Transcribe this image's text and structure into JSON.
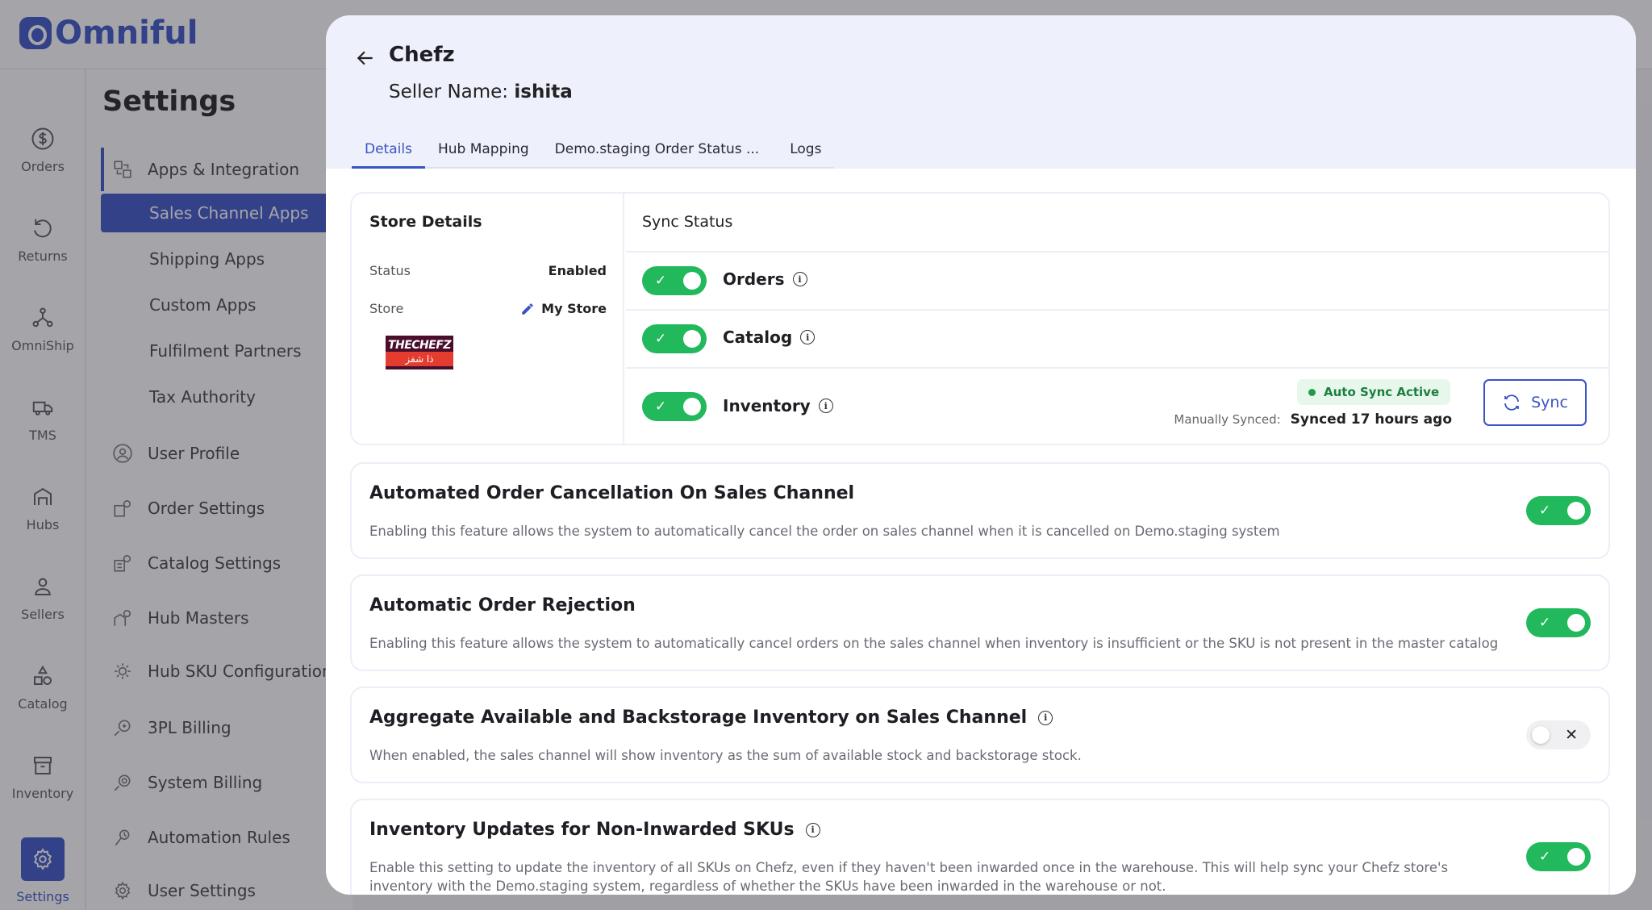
{
  "brand": {
    "name": "Omniful"
  },
  "rail": {
    "items": [
      {
        "label": "Orders",
        "icon": "dollar-circle-icon"
      },
      {
        "label": "Returns",
        "icon": "return-arrow-icon"
      },
      {
        "label": "OmniShip",
        "icon": "network-icon"
      },
      {
        "label": "TMS",
        "icon": "truck-icon"
      },
      {
        "label": "Hubs",
        "icon": "warehouse-icon"
      },
      {
        "label": "Sellers",
        "icon": "user-icon"
      },
      {
        "label": "Catalog",
        "icon": "shapes-icon"
      },
      {
        "label": "Inventory",
        "icon": "box-icon"
      },
      {
        "label": "Settings",
        "icon": "gear-icon"
      }
    ]
  },
  "settings": {
    "title": "Settings",
    "nav": {
      "apps_integration": "Apps & Integration",
      "sales_channel_apps": "Sales Channel Apps",
      "shipping_apps": "Shipping Apps",
      "custom_apps": "Custom Apps",
      "fulfilment_partners": "Fulfilment Partners",
      "tax_authority": "Tax Authority",
      "user_profile": "User Profile",
      "order_settings": "Order Settings",
      "catalog_settings": "Catalog Settings",
      "hub_masters": "Hub Masters",
      "hub_sku_configuration": "Hub SKU Configuration",
      "threepl_billing": "3PL Billing",
      "system_billing": "System Billing",
      "automation_rules": "Automation Rules",
      "user_settings": "User Settings"
    }
  },
  "drawer": {
    "title": "Chefz",
    "seller_label": "Seller Name:",
    "seller_name": "ishita",
    "tabs": [
      "Details",
      "Hub Mapping",
      "Demo.staging Order Status ...",
      "Logs"
    ],
    "active_tab": "Details"
  },
  "store": {
    "heading": "Store Details",
    "status_label": "Status",
    "status_value": "Enabled",
    "store_label": "Store",
    "store_value": "My Store",
    "logo_line1": "THECHEFZ",
    "logo_line2": "ذا شفز"
  },
  "sync": {
    "heading": "Sync Status",
    "rows": [
      {
        "label": "Orders",
        "enabled": true
      },
      {
        "label": "Catalog",
        "enabled": true
      },
      {
        "label": "Inventory",
        "enabled": true
      }
    ],
    "auto_sync_badge": "Auto Sync Active",
    "manual_label": "Manually Synced:",
    "manual_value": "Synced 17 hours ago",
    "sync_button": "Sync"
  },
  "features": [
    {
      "title": "Automated Order Cancellation On Sales Channel",
      "description": "Enabling this feature allows the system to automatically cancel the order on sales channel when it is cancelled on Demo.staging system",
      "enabled": true,
      "info": false
    },
    {
      "title": "Automatic Order Rejection",
      "description": "Enabling this feature allows the system to automatically cancel orders on the sales channel when inventory is insufficient or the SKU is not present in the master catalog",
      "enabled": true,
      "info": false
    },
    {
      "title": "Aggregate Available and Backstorage Inventory on Sales Channel",
      "description": "When enabled, the sales channel will show inventory as the sum of available stock and backstorage stock.",
      "enabled": false,
      "info": true
    },
    {
      "title": "Inventory Updates for Non-Inwarded SKUs",
      "description": "Enable this setting to update the inventory of all SKUs on Chefz, even if they haven't been inwarded once in the warehouse. This will help sync your Chefz store's inventory with the Demo.staging system, regardless of whether the SKUs have been inwarded in the warehouse or not.",
      "enabled": true,
      "info": true
    }
  ],
  "colors": {
    "primary": "#3a53c7",
    "toggle_on": "#22b95d",
    "auto_sync_bg": "#e7f7ec"
  }
}
